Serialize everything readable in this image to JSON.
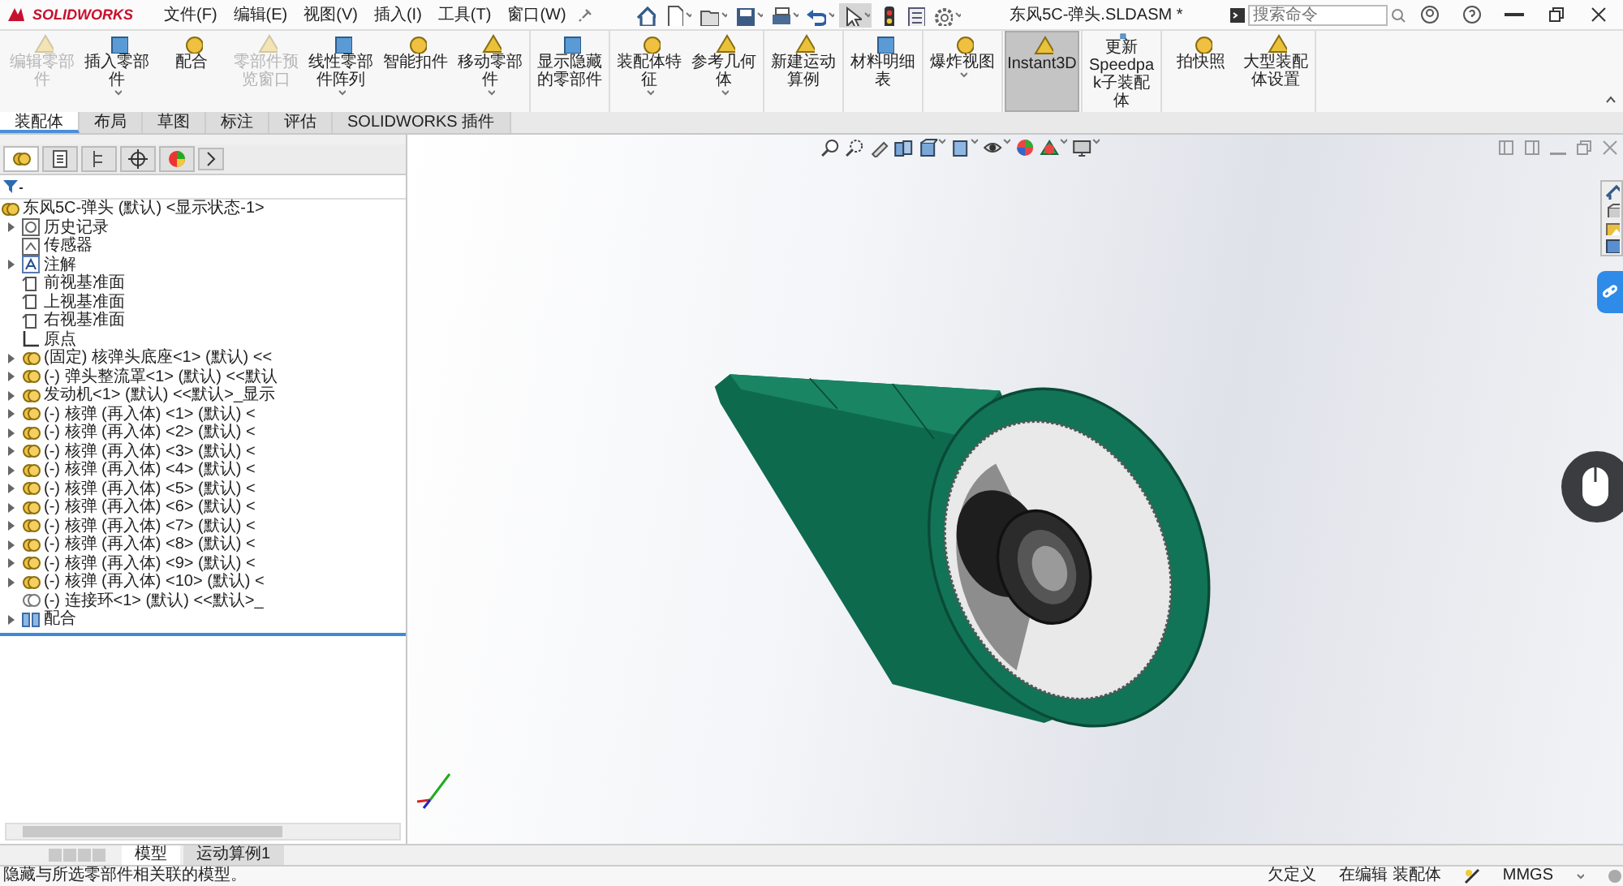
{
  "title_bar": {
    "app_name": "SOLIDWORKS",
    "menus": [
      "文件(F)",
      "编辑(E)",
      "视图(V)",
      "插入(I)",
      "工具(T)",
      "窗口(W)"
    ],
    "document_title": "东风5C-弹头.SLDASM *",
    "search": {
      "placeholder": "搜索命令"
    }
  },
  "ribbon": {
    "groups": [
      {
        "commands": [
          {
            "label": "编辑零部件",
            "disabled": true,
            "selected": false,
            "dropdown": false
          },
          {
            "label": "插入零部件",
            "disabled": false,
            "selected": false,
            "dropdown": true
          },
          {
            "label": "配合",
            "disabled": false,
            "selected": false,
            "dropdown": false
          },
          {
            "label": "零部件预览窗口",
            "disabled": true,
            "selected": false,
            "dropdown": false
          },
          {
            "label": "线性零部件阵列",
            "disabled": false,
            "selected": false,
            "dropdown": true
          },
          {
            "label": "智能扣件",
            "disabled": false,
            "selected": false,
            "dropdown": false
          },
          {
            "label": "移动零部件",
            "disabled": false,
            "selected": false,
            "dropdown": true
          }
        ]
      },
      {
        "commands": [
          {
            "label": "显示隐藏的零部件",
            "disabled": false,
            "selected": false,
            "dropdown": false
          }
        ]
      },
      {
        "commands": [
          {
            "label": "装配体特征",
            "disabled": false,
            "selected": false,
            "dropdown": true
          },
          {
            "label": "参考几何体",
            "disabled": false,
            "selected": false,
            "dropdown": true
          }
        ]
      },
      {
        "commands": [
          {
            "label": "新建运动算例",
            "disabled": false,
            "selected": false,
            "dropdown": false
          }
        ]
      },
      {
        "commands": [
          {
            "label": "材料明细表",
            "disabled": false,
            "selected": false,
            "dropdown": false
          }
        ]
      },
      {
        "commands": [
          {
            "label": "爆炸视图",
            "disabled": false,
            "selected": false,
            "dropdown": true
          }
        ]
      },
      {
        "commands": [
          {
            "label": "Instant3D",
            "disabled": false,
            "selected": true,
            "dropdown": false
          }
        ]
      },
      {
        "commands": [
          {
            "label": "更新Speedpak子装配体",
            "disabled": false,
            "selected": false,
            "dropdown": false
          }
        ]
      },
      {
        "commands": [
          {
            "label": "拍快照",
            "disabled": false,
            "selected": false,
            "dropdown": false
          },
          {
            "label": "大型装配体设置",
            "disabled": false,
            "selected": false,
            "dropdown": false
          }
        ]
      }
    ]
  },
  "command_tabs": [
    {
      "label": "装配体",
      "selected": true
    },
    {
      "label": "布局",
      "selected": false
    },
    {
      "label": "草图",
      "selected": false
    },
    {
      "label": "标注",
      "selected": false
    },
    {
      "label": "评估",
      "selected": false
    },
    {
      "label": "SOLIDWORKS 插件",
      "selected": false
    }
  ],
  "feature_tree": {
    "root": {
      "kind": "assembly",
      "label": "东风5C-弹头 (默认) <显示状态-1>",
      "expandable": false,
      "children": [
        {
          "kind": "history",
          "label": "历史记录",
          "expandable": true
        },
        {
          "kind": "sensor",
          "label": "传感器",
          "expandable": false
        },
        {
          "kind": "annotation",
          "label": "注解",
          "expandable": true
        },
        {
          "kind": "plane",
          "label": "前视基准面",
          "expandable": false
        },
        {
          "kind": "plane",
          "label": "上视基准面",
          "expandable": false
        },
        {
          "kind": "plane",
          "label": "右视基准面",
          "expandable": false
        },
        {
          "kind": "origin",
          "label": "原点",
          "expandable": false
        },
        {
          "kind": "part",
          "label": "(固定) 核弹头底座<1> (默认) <<",
          "expandable": true
        },
        {
          "kind": "part",
          "label": "(-) 弹头整流罩<1> (默认) <<默认",
          "expandable": true
        },
        {
          "kind": "part",
          "label": "发动机<1> (默认) <<默认>_显示",
          "expandable": true
        },
        {
          "kind": "part",
          "label": "(-) 核弹 (再入体) <1> (默认) <",
          "expandable": true
        },
        {
          "kind": "part",
          "label": "(-) 核弹 (再入体) <2> (默认) <",
          "expandable": true
        },
        {
          "kind": "part",
          "label": "(-) 核弹 (再入体) <3> (默认) <",
          "expandable": true
        },
        {
          "kind": "part",
          "label": "(-) 核弹 (再入体) <4> (默认) <",
          "expandable": true
        },
        {
          "kind": "part",
          "label": "(-) 核弹 (再入体) <5> (默认) <",
          "expandable": true
        },
        {
          "kind": "part",
          "label": "(-) 核弹 (再入体) <6> (默认) <",
          "expandable": true
        },
        {
          "kind": "part",
          "label": "(-) 核弹 (再入体) <7> (默认) <",
          "expandable": true
        },
        {
          "kind": "part",
          "label": "(-) 核弹 (再入体) <8> (默认) <",
          "expandable": true
        },
        {
          "kind": "part",
          "label": "(-) 核弹 (再入体) <9> (默认) <",
          "expandable": true
        },
        {
          "kind": "part",
          "label": "(-) 核弹 (再入体) <10> (默认) <",
          "expandable": true
        },
        {
          "kind": "part-outline",
          "label": "(-) 连接环<1> (默认) <<默认>_",
          "expandable": false
        },
        {
          "kind": "mates",
          "label": "配合",
          "expandable": true
        }
      ]
    }
  },
  "bottom_tabs": [
    {
      "label": "模型",
      "selected": true
    },
    {
      "label": "运动算例1",
      "selected": false
    }
  ],
  "status_bar": {
    "message": "隐藏与所选零部件相关联的模型。",
    "definition": "欠定义",
    "mode": "在编辑 装配体",
    "units": "MMGS"
  }
}
